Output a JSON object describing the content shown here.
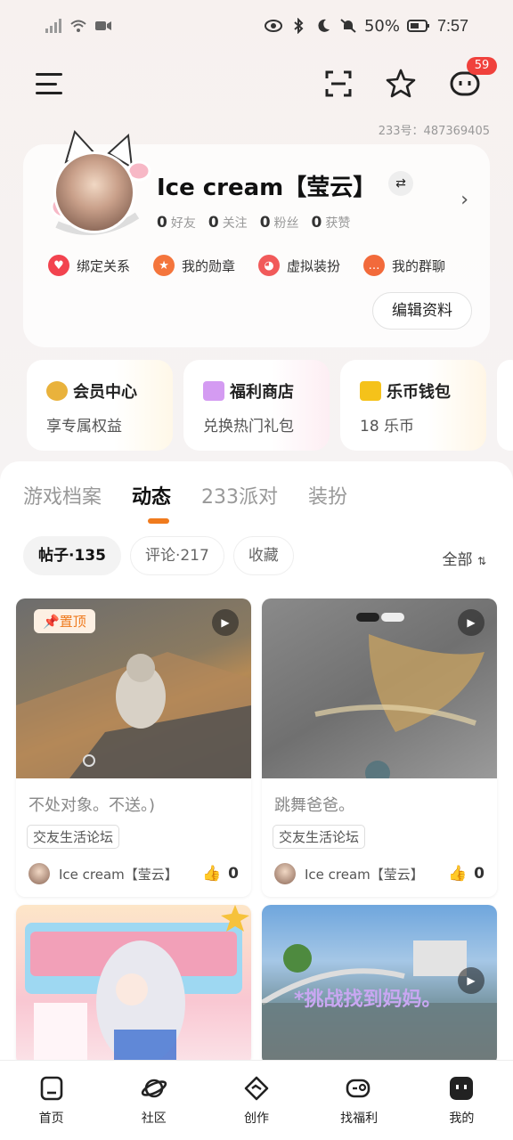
{
  "status_bar": {
    "battery": "50%",
    "time": "7:57"
  },
  "header": {
    "notification_count": "59",
    "user_id_label": "233号：487369405"
  },
  "profile": {
    "username": "Ice cream【莹云】",
    "stats": [
      {
        "value": "0",
        "label": "好友"
      },
      {
        "value": "0",
        "label": "关注"
      },
      {
        "value": "0",
        "label": "粉丝"
      },
      {
        "value": "0",
        "label": "获赞"
      }
    ],
    "actions": [
      {
        "label": "绑定关系",
        "color": "#f2434f"
      },
      {
        "label": "我的勋章",
        "color": "#f4753c"
      },
      {
        "label": "虚拟装扮",
        "color": "#f15a5a"
      },
      {
        "label": "我的群聊",
        "color": "#f26a3b"
      }
    ],
    "edit_label": "编辑资料"
  },
  "quick_cards": [
    {
      "title": "会员中心",
      "subtitle": "享专属权益",
      "icon_color": "#e9b23c"
    },
    {
      "title": "福利商店",
      "subtitle": "兑换热门礼包",
      "icon_color": "#d49bf2"
    },
    {
      "title": "乐币钱包",
      "subtitle": "18 乐币",
      "icon_color": "#f5c21a"
    }
  ],
  "tabs": [
    "游戏档案",
    "动态",
    "233派对",
    "装扮"
  ],
  "active_tab": "动态",
  "subtabs": [
    "帖子·135",
    "评论·217",
    "收藏"
  ],
  "filter_label": "全部",
  "posts": [
    {
      "title": "不处对象。不送。)",
      "tag": "交友生活论坛",
      "author": "Ice cream【莹云】",
      "likes": "0",
      "pinned_label": "置顶"
    },
    {
      "title": "跳舞爸爸。",
      "tag": "交友生活论坛",
      "author": "Ice cream【莹云】",
      "likes": "0"
    },
    {
      "title": "",
      "overlay_text": ""
    },
    {
      "title": "",
      "overlay_text": "*挑战找到妈妈。"
    }
  ],
  "bottom_nav": [
    "首页",
    "社区",
    "创作",
    "找福利",
    "我的"
  ]
}
